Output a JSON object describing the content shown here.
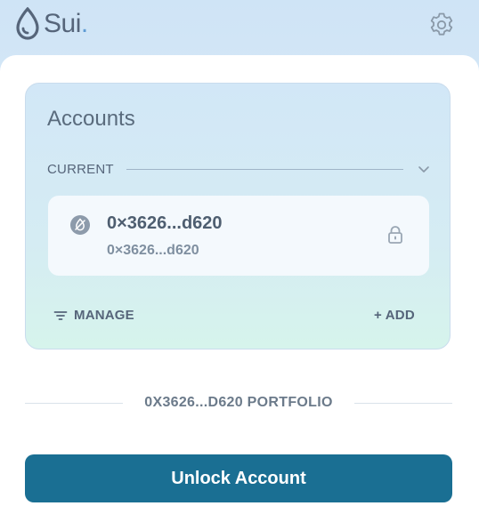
{
  "header": {
    "logo_text": "Sui",
    "logo_dot": ".",
    "settings_icon": "gear-icon"
  },
  "accounts": {
    "title": "Accounts",
    "current_label": "CURRENT",
    "current_account": {
      "name": "0×3626...d620",
      "address": "0×3626...d620"
    },
    "manage_label": "MANAGE",
    "add_label": "+ ADD"
  },
  "portfolio": {
    "label": "0X3626...D620 PORTFOLIO"
  },
  "unlock_button": {
    "label": "Unlock Account"
  },
  "colors": {
    "accent": "#1a6f93",
    "logo_accent": "#5f9cd4"
  }
}
